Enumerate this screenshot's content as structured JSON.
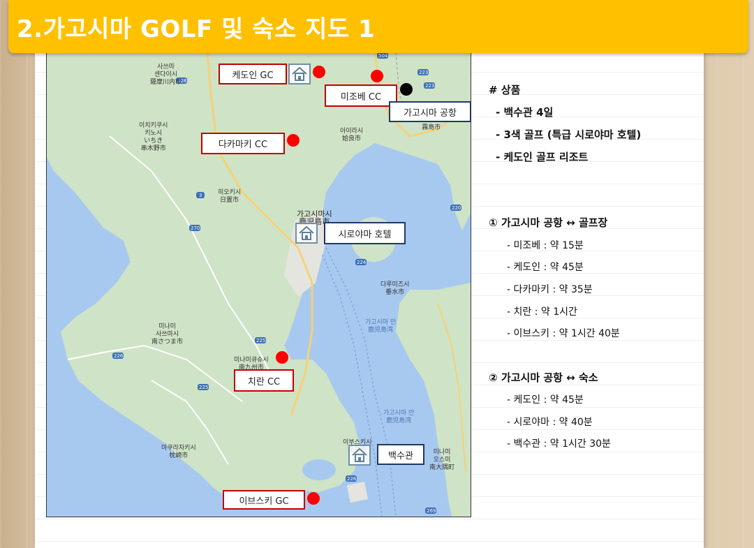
{
  "header": {
    "title": "2.가고시마 GOLF 및 숙소 지도 1"
  },
  "map": {
    "labels": {
      "kedoin_gc": "케도인 GC",
      "mizobe_cc": "미조베 CC",
      "airport": "가고시마 공항",
      "takamaki_cc": "다카마키 CC",
      "shiroyama_hotel": "시로야마 호텔",
      "chiran_cc": "치란 CC",
      "baeksugwan": "백수관",
      "ibusuki_gc": "이브스키 GC"
    },
    "place_names": {
      "satsumasendai": "사쓰마\n센다이시\n薩摩川内市",
      "ichikikushikino": "이치키쿠시\n키노시\nいちき\n串木野市",
      "aira": "아이라시\n姶良市",
      "kirishima": "기리시마시\n霧島市",
      "hioki": "히오키시\n日置市",
      "kagoshima": "가고시마시\n鹿児島市",
      "tarumizu": "다루미즈시\n垂水市",
      "bay_north": "가고시마 만\n鹿児島湾",
      "minamisatsuma": "미나미\n사쓰마시\n南さつま市",
      "minamikyushu": "미나미큐슈시\n南九州市",
      "makurazaki": "마쿠라자키시\n枕崎市",
      "bay_south": "가고시마 만\n鹿児島湾",
      "ibusuki": "이부스키시\n指宿市",
      "minamiosumi": "미나미\n오스미\n南大隅町"
    },
    "road_numbers": [
      "328",
      "504",
      "223",
      "223",
      "3",
      "270",
      "220",
      "224",
      "226",
      "225",
      "225",
      "226",
      "269"
    ]
  },
  "info": {
    "product": {
      "heading": "# 상품",
      "items": [
        "- 백수관 4일",
        "- 3색 골프 (특급 시로야마 호텔)",
        "- 케도인 골프 리조트"
      ]
    },
    "airport_golf": {
      "heading": "① 가고시마 공항 ↔ 골프장",
      "items": [
        "- 미조베 : 약 15분",
        "- 케도인 : 약 45분",
        "- 다카마키 : 약 35분",
        "- 치란 : 약 1시간",
        "- 이브스키 : 약 1시간 40분"
      ]
    },
    "airport_hotel": {
      "heading": "② 가고시마 공항 ↔ 숙소",
      "items": [
        "- 케도인 : 약 45분",
        "- 시로야마 : 약 40분",
        "- 백수관 : 약 1시간 30분"
      ]
    }
  },
  "colors": {
    "header": "#ffc000",
    "golf_box": "#c00000",
    "lodging_box": "#1f3864",
    "marker": "#ff0000",
    "sea": "#a8c9ef",
    "land": "#cfe3c6"
  }
}
